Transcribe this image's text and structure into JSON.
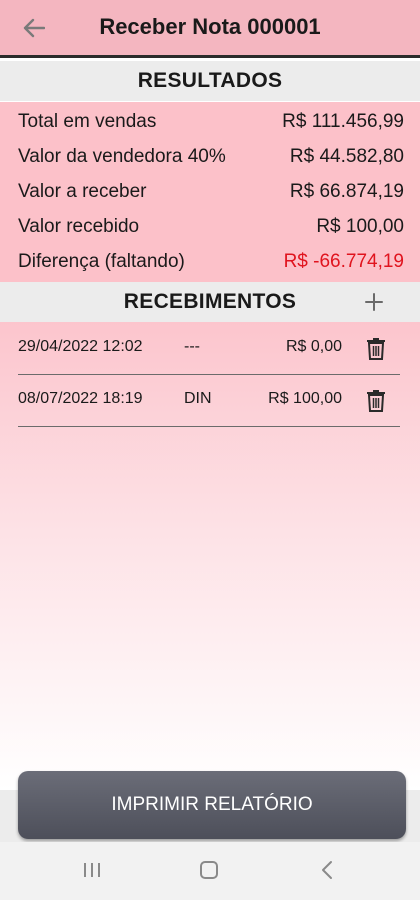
{
  "app_bar": {
    "title": "Receber Nota 000001",
    "back_icon": "arrow-left-icon"
  },
  "results": {
    "heading": "RESULTADOS",
    "rows": [
      {
        "label": "Total em vendas",
        "value": "R$ 111.456,99"
      },
      {
        "label": "Valor da vendedora 40%",
        "value": "R$ 44.582,80"
      },
      {
        "label": "Valor a receber",
        "value": "R$ 66.874,19"
      },
      {
        "label": "Valor recebido",
        "value": "R$ 100,00"
      },
      {
        "label": "Diferença (faltando)",
        "value": "R$ -66.774,19"
      }
    ],
    "negative_color": "#e0141e"
  },
  "receipts": {
    "heading": "RECEBIMENTOS",
    "add_icon": "plus-icon",
    "items": [
      {
        "datetime": "29/04/2022 12:02",
        "method": "---",
        "amount": "R$ 0,00"
      },
      {
        "datetime": "08/07/2022 18:19",
        "method": "DIN",
        "amount": "R$ 100,00"
      }
    ],
    "delete_icon": "trash-icon"
  },
  "actions": {
    "print_label": "IMPRIMIR RELATÓRIO"
  },
  "system_nav": {
    "recents_icon": "recents-icon",
    "home_icon": "home-icon",
    "back_icon": "chevron-left-icon"
  },
  "colors": {
    "app_bar": "#f4b6c0",
    "results_bg": "#fcc1c9",
    "section_header": "#ececec",
    "button": "#5a5c67"
  }
}
